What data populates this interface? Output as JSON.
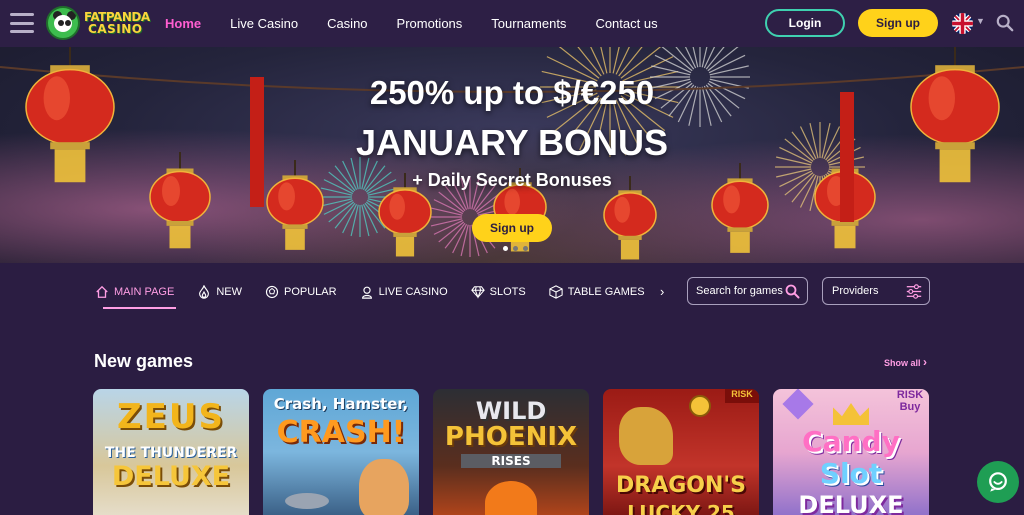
{
  "header": {
    "logo_line1": "FATPANDA",
    "logo_line2": "CASINO",
    "nav": [
      {
        "label": "Home",
        "active": true
      },
      {
        "label": "Live Casino"
      },
      {
        "label": "Casino"
      },
      {
        "label": "Promotions"
      },
      {
        "label": "Tournaments"
      },
      {
        "label": "Contact us"
      }
    ],
    "login_label": "Login",
    "signup_label": "Sign up",
    "language_icon": "uk-flag-icon"
  },
  "hero": {
    "title": "250% up to $/€250",
    "subtitle": "JANUARY BONUS",
    "tagline": "+ Daily Secret Bonuses",
    "button_label": "Sign up",
    "slides": 3,
    "active_slide": 1
  },
  "categories": {
    "items": [
      {
        "label": "MAIN PAGE",
        "icon": "home-icon",
        "active": true
      },
      {
        "label": "NEW",
        "icon": "flame-icon"
      },
      {
        "label": "POPULAR",
        "icon": "ball-icon"
      },
      {
        "label": "LIVE CASINO",
        "icon": "dealer-icon"
      },
      {
        "label": "SLOTS",
        "icon": "diamond-icon"
      },
      {
        "label": "TABLE GAMES",
        "icon": "dice-icon"
      }
    ],
    "search_placeholder": "Search for games",
    "providers_label": "Providers"
  },
  "new_games": {
    "title": "New games",
    "show_all": "Show all",
    "games": [
      {
        "line1": "ZEUS",
        "line2": "THE THUNDERER",
        "line3": "DELUXE"
      },
      {
        "line1": "Crash, Hamster,",
        "line2": "CRASH!",
        "line3": ""
      },
      {
        "line1": "WILD",
        "line2": "PHOENIX",
        "line3": "RISES"
      },
      {
        "line1": "DRAGON'S",
        "line2": "LUCKY 25",
        "line3": "RISK"
      },
      {
        "line1": "Candy",
        "line2": "Slot",
        "line3": "DELUXE"
      }
    ]
  },
  "colors": {
    "accent": "#ff5ed1",
    "button": "#ffd21a",
    "background": "#2b1d42",
    "login_border": "#3fd1b0"
  }
}
